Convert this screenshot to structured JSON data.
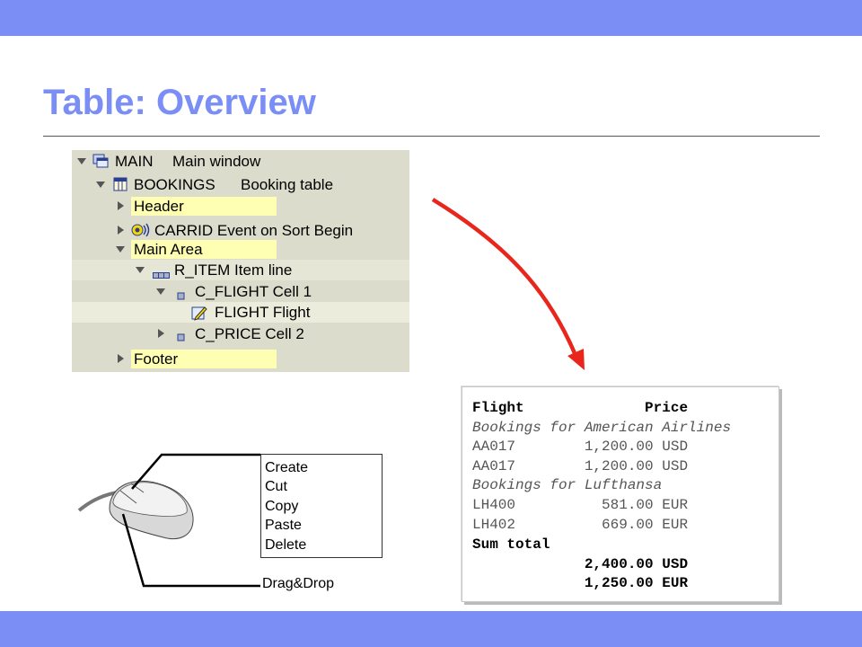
{
  "slide": {
    "title": "Table: Overview"
  },
  "tree": {
    "rows": [
      {
        "name": "MAIN",
        "desc": "Main window"
      },
      {
        "name": "BOOKINGS",
        "desc": "Booking table"
      },
      {
        "name": "Header"
      },
      {
        "name": "CARRID Event on Sort Begin"
      },
      {
        "name": "Main Area"
      },
      {
        "name": "R_ITEM Item line"
      },
      {
        "name": "C_FLIGHT Cell 1"
      },
      {
        "name": "FLIGHT Flight"
      },
      {
        "name": "C_PRICE Cell 2"
      },
      {
        "name": "Footer"
      }
    ]
  },
  "report": {
    "lines": [
      "Flight              Price",
      "Bookings for American Airlines",
      "AA017        1,200.00 USD",
      "AA017        1,200.00 USD",
      "Bookings for Lufthansa",
      "LH400          581.00 EUR",
      "LH402          669.00 EUR",
      "Sum total",
      "             2,400.00 USD",
      "             1,250.00 EUR"
    ]
  },
  "context_menu": {
    "items": [
      "Create",
      "Cut",
      "Copy",
      "Paste",
      "Delete"
    ]
  },
  "mouse": {
    "drag_label": "Drag&Drop"
  },
  "colors": {
    "accent": "#7b8ef5",
    "arrow": "#e8261c",
    "highlight": "#ffffb4",
    "tree_bg": "#dcdccc"
  }
}
